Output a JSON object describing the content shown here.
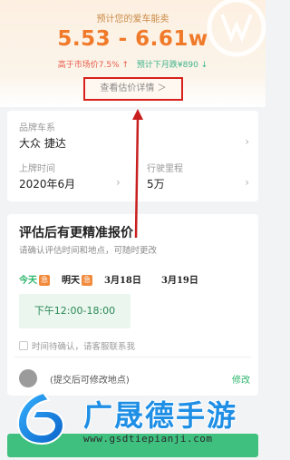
{
  "valuation": {
    "predict_label": "预计您的爱车能卖",
    "price_range": "5.53 - 6.61w",
    "market_diff": "高于市场价7.5% ↑",
    "next_month": "预计下月跌¥890 ↓",
    "detail_button": "查看估价详情 ＞"
  },
  "car_info": {
    "model_label": "品牌车系",
    "model_value": "大众 捷达",
    "reg_label": "上牌时间",
    "reg_value": "2020年6月",
    "mileage_label": "行驶里程",
    "mileage_value": "5万",
    "chevron": "›"
  },
  "evaluation": {
    "title": "评估后有更精准报价",
    "subtitle": "请确认评估时间和地点，可随时更改",
    "days": [
      {
        "label": "今天",
        "badge": "急"
      },
      {
        "label": "明天",
        "badge": "急"
      },
      {
        "label": "3月18日"
      },
      {
        "label": "3月19日"
      }
    ],
    "time_slot": "下午12:00-18:00",
    "pending_check": "时间待确认，请客服联系我",
    "location_text": "(提交后可修改地点)",
    "location_link": "修改"
  },
  "colors": {
    "accent_orange": "#f07a2a",
    "accent_green": "#2bb56b",
    "highlight_red": "#d8201c"
  },
  "watermark": {
    "name": "广晟德手游",
    "url": "www.gsdtiepianji.com"
  }
}
